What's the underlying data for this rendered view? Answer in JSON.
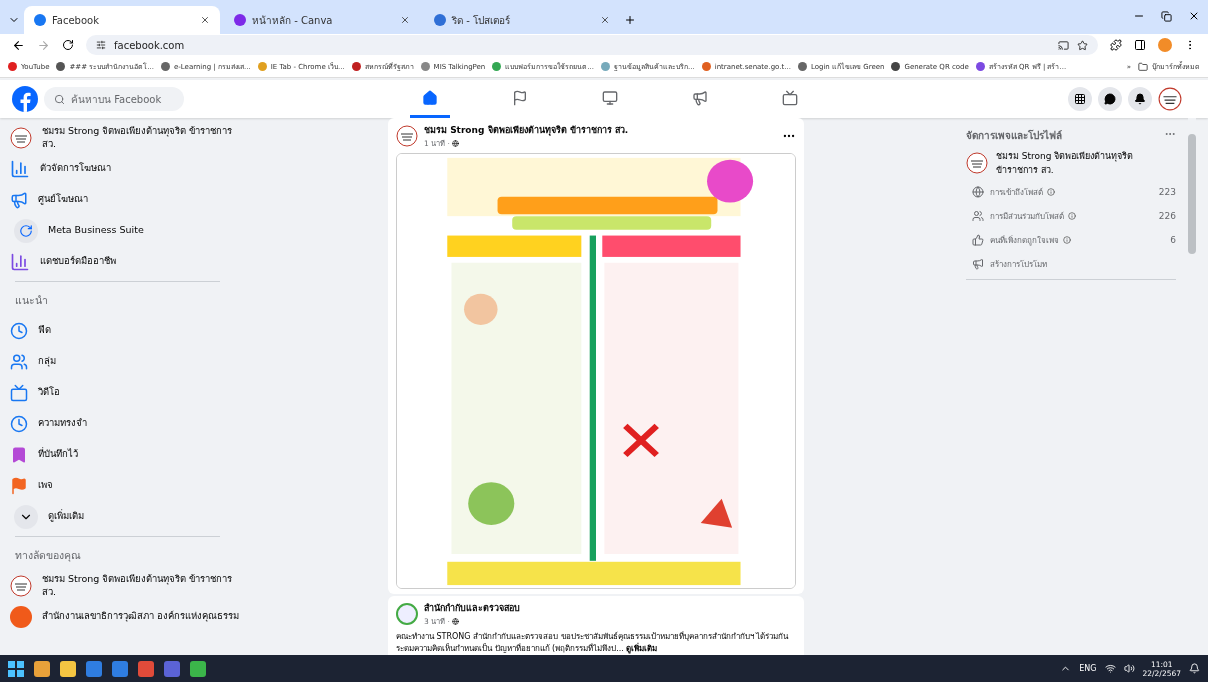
{
  "browser": {
    "tabs": [
      {
        "title": "Facebook",
        "selected": true
      },
      {
        "title": "หน้าหลัก - Canva",
        "selected": false
      },
      {
        "title": "ริด - โปสเตอร์",
        "selected": false
      }
    ],
    "address": "facebook.com",
    "bookmarks": [
      "YouTube",
      "### ระบบสำนักงานอัตโ...",
      "e-Learning | กรมส่งเส...",
      "IE Tab - Chrome เว็บ...",
      "สหกรณ์ที่รัฐสภา",
      "MIS TalkingPen",
      "แบบฟอร์มการขอใช้รถยนต...",
      "ฐานข้อมูลสินค้าและบริก...",
      "intranet.senate.go.t...",
      "Login แก้ไขเลข Green",
      "Generate QR code",
      "สร้างรหัส QR ฟรี | สร้า..."
    ],
    "more_bookmarks": "»",
    "all_bookmarks": "บุ๊กมาร์กทั้งหมด"
  },
  "header": {
    "search": {
      "placeholder": "ค้นหาบน Facebook"
    },
    "nav": [
      {
        "selected": true
      },
      {
        "selected": false
      },
      {
        "selected": false
      },
      {
        "selected": false
      },
      {
        "selected": false
      }
    ]
  },
  "sidebar": {
    "top": [
      "ชมรม Strong จิตพอเพียงต้านทุจริต ข้าราชการ สว.",
      "ตัวจัดการโฆษณา",
      "ศูนย์โฆษณา",
      "Meta Business Suite",
      "แดชบอร์ดมืออาชีพ"
    ],
    "suggested_heading": "แนะนำ",
    "suggested": [
      "ฟีด",
      "กลุ่ม",
      "วิดีโอ",
      "ความทรงจำ",
      "ที่บันทึกไว้",
      "เพจ",
      "ดูเพิ่มเติม"
    ],
    "shortcuts_heading": "ทางลัดของคุณ",
    "shortcuts": [
      "ชมรม Strong จิตพอเพียงต้านทุจริต ข้าราชการ สว.",
      "สำนักงานเลขาธิการวุฒิสภา องค์กรแห่งคุณธรรม"
    ]
  },
  "feed": [
    {
      "author": "ชมรม Strong จิตพอเพียงต้านทุจริต ข้าราชการ สว.",
      "time": "1 นาที ·"
    },
    {
      "author": "สำนักกำกับและตรวจสอบ",
      "time": "3 นาที ·",
      "text": "คณะทำงาน STRONG สำนักกำกับและตรวจสอบ ขอประชาสัมพันธ์คุณธรรมเป้าหมายที่บุคลากรสำนักกำกับฯ ได้ร่วมกันระดมความคิดเห็นกำหนดเป็น ปัญหาที่อยากแก้ (พฤติกรรมที่ไม่พึงป... **ดูเพิ่มเติม**"
    }
  ],
  "right_panel": {
    "title": "จัดการเพจและโปรไฟล์",
    "page": "ชมรม Strong จิตพอเพียงต้านทุจริต ข้าราชการ สว.",
    "stats": [
      {
        "label": "การเข้าถึงโพสต์",
        "value": "223"
      },
      {
        "label": "การมีส่วนร่วมกับโพสต์",
        "value": "226"
      },
      {
        "label": "คนที่เพิ่งกดถูกใจเพจ",
        "value": "6"
      }
    ],
    "promote": "สร้างการโปรโมท"
  },
  "taskbar": {
    "language": "ENG",
    "time": "11:01",
    "date": "22/2/2567"
  }
}
